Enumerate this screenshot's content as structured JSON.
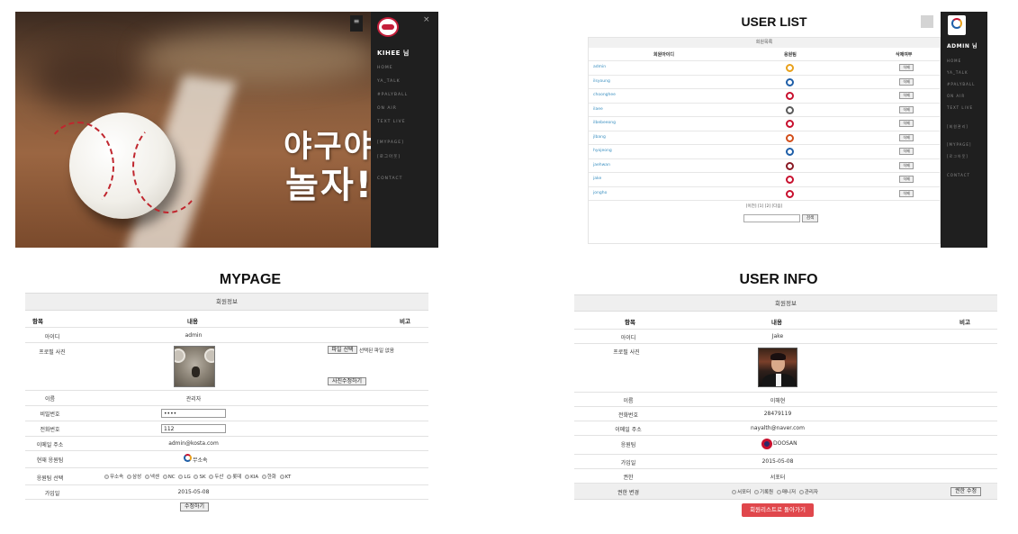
{
  "hero": {
    "headline_line1": "야구야",
    "headline_line2": "놀자!",
    "menu_icon": "≡",
    "close_icon": "×",
    "sidebar": {
      "user": "KIHEE 님",
      "items": [
        "HOME",
        "YA_TALK",
        "#PALYBALL",
        "ON AIR",
        "TEXT LIVE",
        "[MYPAGE]",
        "[로그아웃]",
        "CONTACT"
      ]
    }
  },
  "user_list": {
    "title": "USER LIST",
    "caption": "회원목록",
    "headers": [
      "회원아이디",
      "응원팀",
      "삭제여부"
    ],
    "rows": [
      {
        "id": "admin",
        "team_color": "#e8a11c"
      },
      {
        "id": "ilsyoung",
        "team_color": "#1f5fa8"
      },
      {
        "id": "choonghee",
        "team_color": "#c8102e"
      },
      {
        "id": "ilaee",
        "team_color": "#5a5a5a"
      },
      {
        "id": "ilbebeeong",
        "team_color": "#c8102e"
      },
      {
        "id": "jlbang",
        "team_color": "#d24e1a"
      },
      {
        "id": "hyojeong",
        "team_color": "#1f5fa8"
      },
      {
        "id": "jaehwan",
        "team_color": "#8a1a24"
      },
      {
        "id": "jake",
        "team_color": "#c8102e"
      },
      {
        "id": "jongho",
        "team_color": "#c8102e"
      }
    ],
    "delete_label": "삭제",
    "pager": "[이전] [1] [2] [다음]",
    "search_button": "검색",
    "sidebar": {
      "user": "ADMIN 님",
      "items": [
        "HOME",
        "YA_TALK",
        "#PALYBALL",
        "ON AIR",
        "TEXT LIVE",
        "[회원관리]",
        "[MYPAGE]",
        "[로그아웃]",
        "CONTACT"
      ]
    }
  },
  "mypage": {
    "title": "MYPAGE",
    "caption": "회원정보",
    "headers": {
      "item": "항목",
      "content": "내용",
      "note": "비고"
    },
    "labels": {
      "id": "아이디",
      "photo": "프로필 사진",
      "name": "이름",
      "password": "비밀번호",
      "phone": "전화번호",
      "email": "이메일 주소",
      "current_team": "현재 응원팀",
      "team_select": "응원팀 선택",
      "joined": "가입일"
    },
    "values": {
      "id": "admin",
      "name": "관리자",
      "password": "••••",
      "phone": "112",
      "email": "admin@kosta.com",
      "current_team": "무소속",
      "joined": "2015-05-08"
    },
    "file_button": "파일 선택",
    "file_status": "선택된 파일 없음",
    "photo_edit_button": "사진수정하기",
    "team_options": [
      "무소속",
      "삼성",
      "넥센",
      "NC",
      "LG",
      "SK",
      "두산",
      "롯데",
      "KIA",
      "한화",
      "KT"
    ],
    "submit_button": "수정하기"
  },
  "user_info": {
    "title": "USER INFO",
    "caption": "회원정보",
    "headers": {
      "item": "항목",
      "content": "내용",
      "note": "비고"
    },
    "labels": {
      "id": "아이디",
      "photo": "프로필 사진",
      "name": "이름",
      "phone": "전화번호",
      "email": "이메일 주소",
      "team": "응원팀",
      "joined": "가입일",
      "role": "권한",
      "role_change": "권한 변경"
    },
    "values": {
      "id": "Jake",
      "name": "이해현",
      "phone": "28479119",
      "email": "nayalth@naver.com",
      "team": "DOOSAN",
      "joined": "2015-05-08",
      "role": "서포터"
    },
    "role_options": [
      "서포터",
      "기록원",
      "매니저",
      "관리자"
    ],
    "role_button": "권한 수정",
    "back_button": "회원리스트로 돌아가기"
  }
}
